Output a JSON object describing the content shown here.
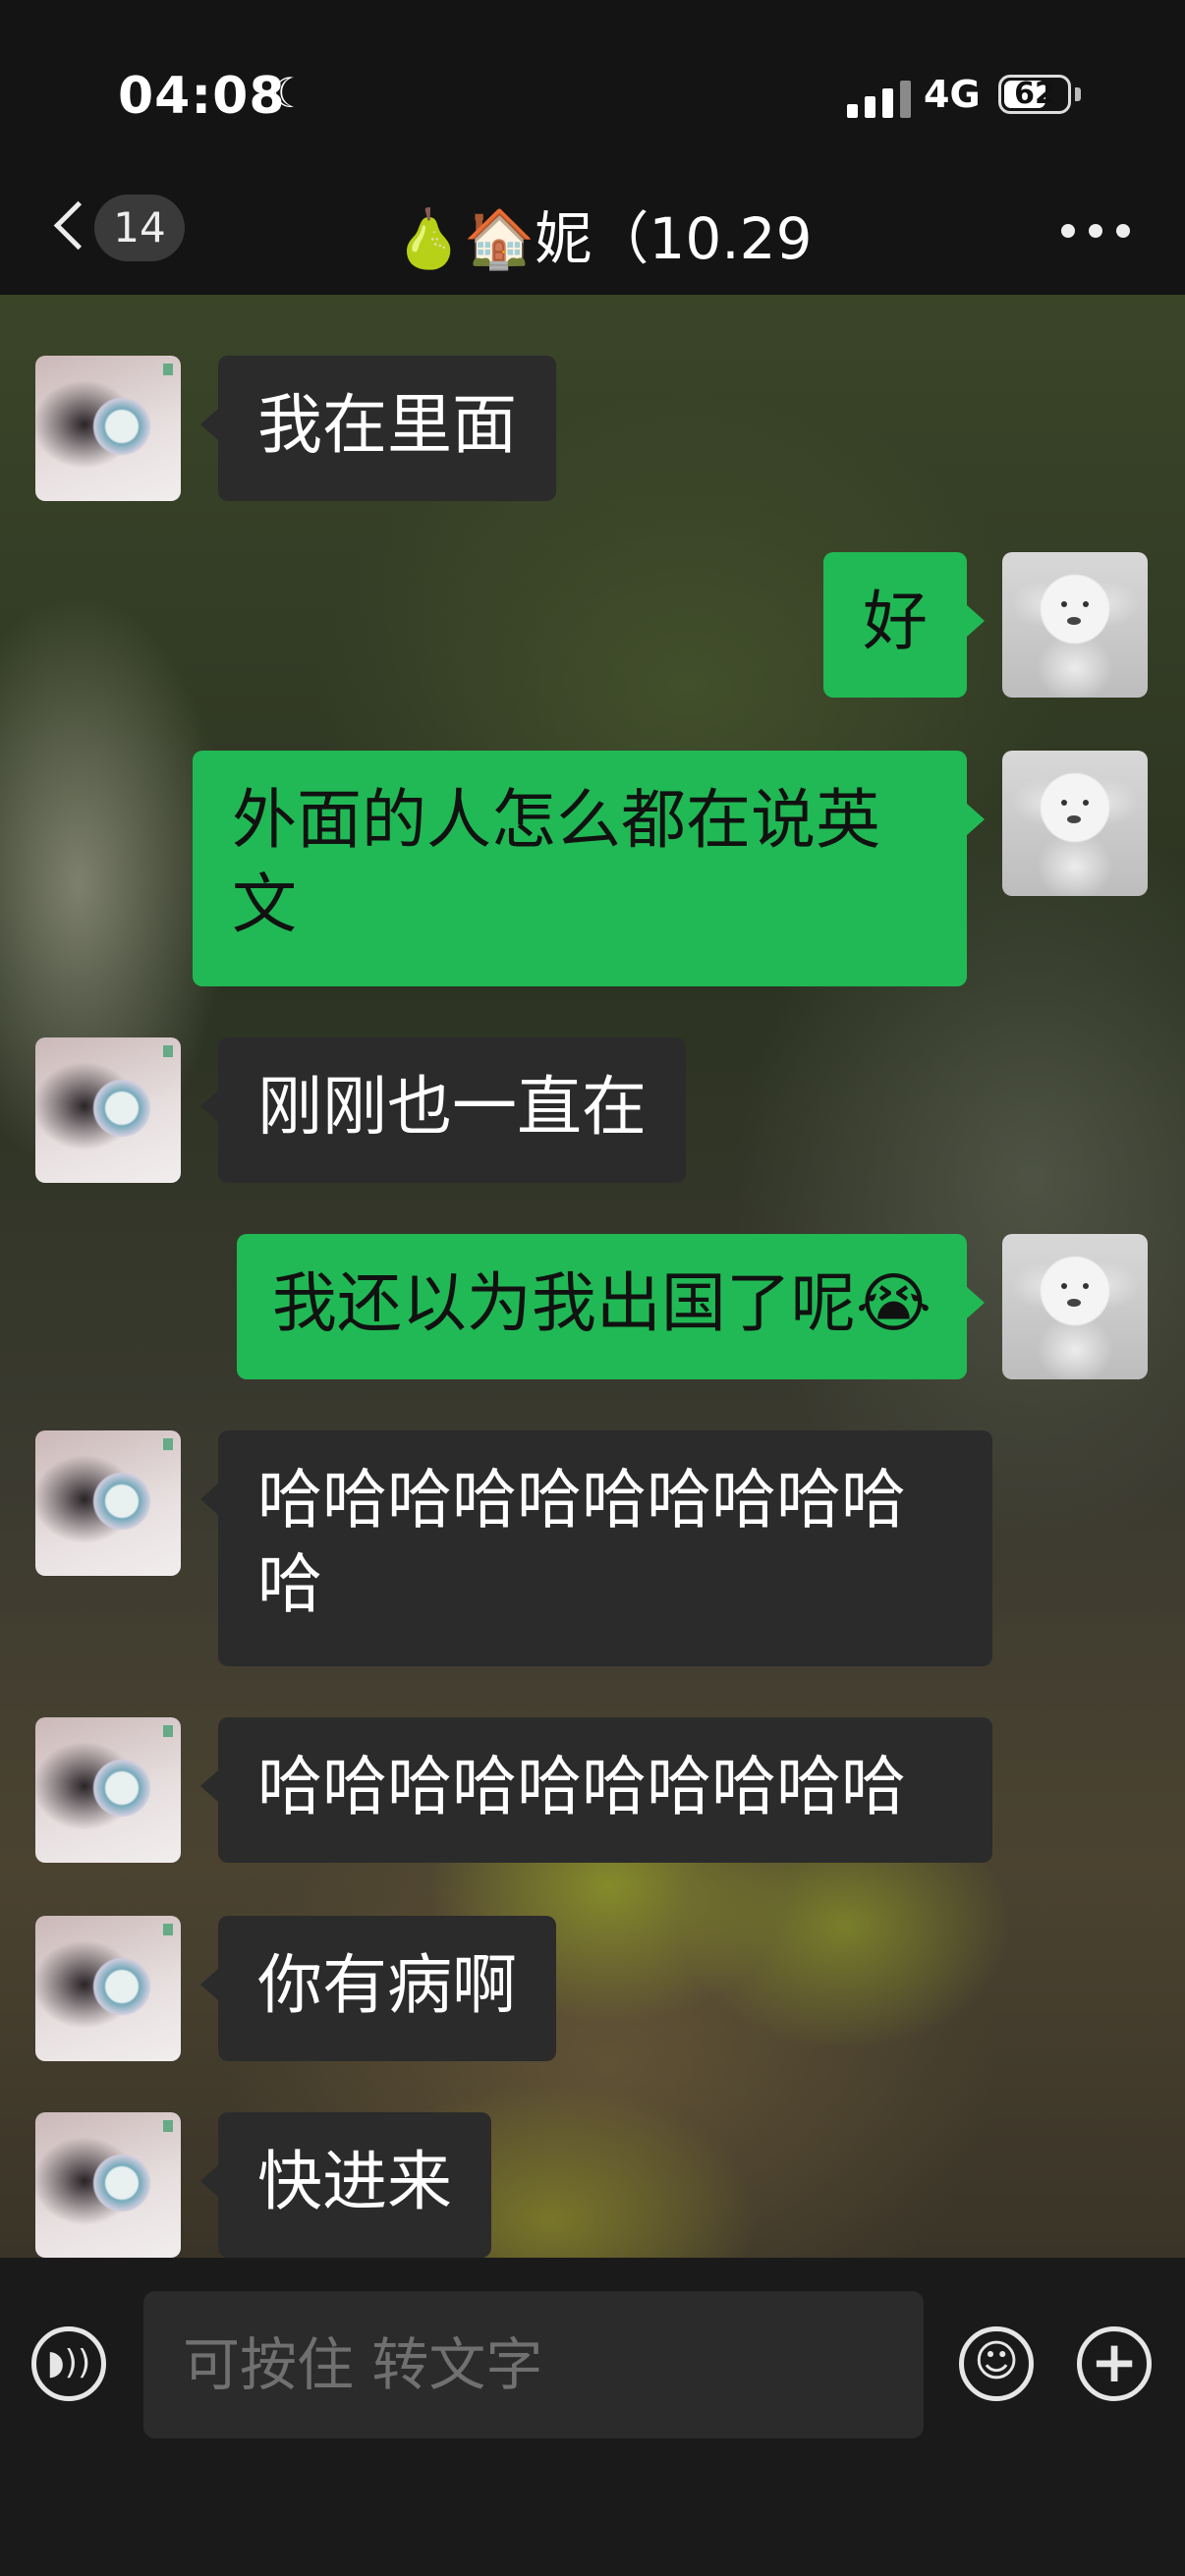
{
  "status_bar": {
    "time": "04:08",
    "moon_icon": "☾",
    "network": "4G",
    "battery": "62"
  },
  "header": {
    "unread_count": "14",
    "title": "🍐🏠妮（10.29"
  },
  "messages": [
    {
      "side": "in",
      "text": "我在里面"
    },
    {
      "side": "out",
      "text": "好"
    },
    {
      "side": "out",
      "text": "外面的人怎么都在说英\n文"
    },
    {
      "side": "in",
      "text": "刚刚也一直在"
    },
    {
      "side": "out",
      "text": "我还以为我出国了呢😭"
    },
    {
      "side": "in",
      "text": "哈哈哈哈哈哈哈哈哈哈\n哈"
    },
    {
      "side": "in",
      "text": "哈哈哈哈哈哈哈哈哈哈"
    },
    {
      "side": "in",
      "text": "你有病啊"
    },
    {
      "side": "in",
      "text": "快进来"
    }
  ],
  "input": {
    "placeholder": "可按住 转文字",
    "voice_icon": "voice-icon",
    "emoji_icon": "emoji-icon",
    "plus_icon": "plus-icon"
  },
  "colors": {
    "outgoing_bubble": "#21b955",
    "incoming_bubble": "#2b2b2b"
  }
}
